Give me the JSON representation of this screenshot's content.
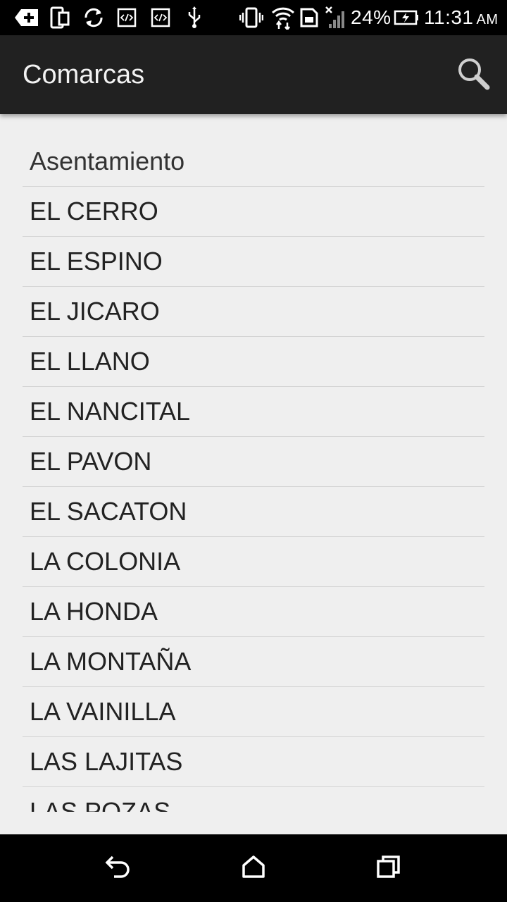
{
  "status_bar": {
    "battery_percent": "24%",
    "time": "11:31",
    "ampm": "AM",
    "icons": [
      "add-notification-icon",
      "device-sync-icon",
      "sync-icon",
      "code-icon",
      "code-icon",
      "usb-icon",
      "vibrate-icon",
      "wifi-icon",
      "sim-card-icon",
      "signal-icon",
      "battery-charging-icon"
    ]
  },
  "action_bar": {
    "title": "Comarcas",
    "search_icon": "search-icon"
  },
  "list": {
    "header": "Asentamiento",
    "items": [
      "EL CERRO",
      "EL ESPINO",
      "EL JICARO",
      "EL LLANO",
      "EL NANCITAL",
      "EL PAVON",
      "EL SACATON",
      "LA COLONIA",
      "LA HONDA",
      "LA MONTAÑA",
      "LA VAINILLA",
      "LAS LAJITAS",
      "LAS POZAS"
    ]
  },
  "nav_bar": {
    "icons": [
      "back-icon",
      "home-icon",
      "recents-icon"
    ]
  },
  "colors": {
    "status_bar": "#000000",
    "action_bar": "#212121",
    "background": "#efefef",
    "divider": "#d4d4d4",
    "text": "#222222"
  }
}
